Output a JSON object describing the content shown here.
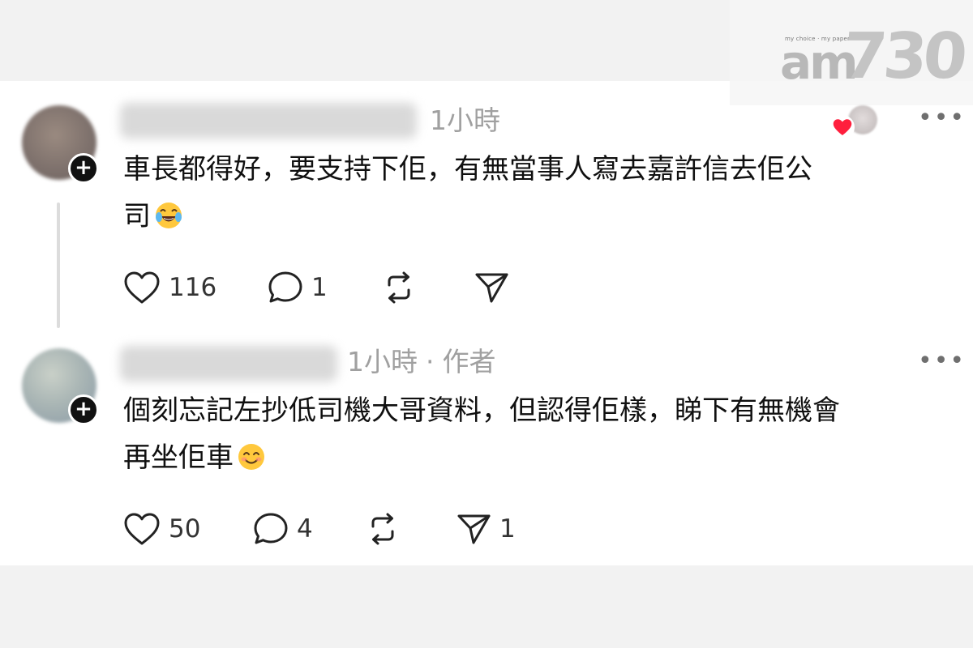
{
  "watermark": {
    "tagline": "my choice · my paper",
    "brand_letters": "am",
    "brand_number": "730"
  },
  "comments": [
    {
      "timestamp": "1小時",
      "text_line1": "車長都得好，要支持下佢，有無當事人寫去嘉許信去佢公",
      "text_line2": "司",
      "emoji": "face-with-tears-of-joy",
      "likes": "116",
      "replies": "1",
      "reposts": "",
      "shares": ""
    },
    {
      "timestamp": "1小時",
      "separator": "·",
      "author_tag": "作者",
      "text_line1": "個刻忘記左抄低司機大哥資料，但認得佢樣，睇下有無機會",
      "text_line2": "再坐佢車",
      "emoji": "smiling-face-with-smiling-eyes",
      "likes": "50",
      "replies": "4",
      "reposts": "",
      "shares": "1"
    }
  ],
  "icons": {
    "like": "heart-outline-icon",
    "reply": "comment-bubble-icon",
    "repost": "repost-arrows-icon",
    "share": "send-plane-icon",
    "more": "more-dots-icon",
    "follow": "plus-icon",
    "liked_by_author": "red-heart-icon"
  },
  "colors": {
    "heart_red": "#ff1f3d",
    "meta_gray": "#a0a0a0",
    "text": "#101010",
    "background": "#ffffff",
    "page": "#f2f2f2"
  }
}
